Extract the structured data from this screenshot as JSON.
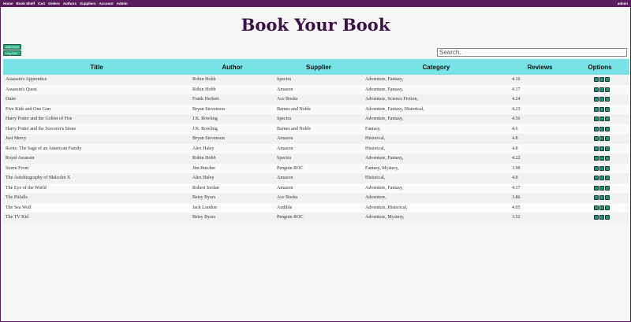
{
  "nav": {
    "links": [
      "Home",
      "Book Shelf",
      "Cart",
      "Orders",
      "Authors",
      "Suppliers",
      "Account",
      "Admin"
    ],
    "user": "admin"
  },
  "page_title": "Book Your Book",
  "buttons": {
    "add_book": "Add Book",
    "logout": "Log Out"
  },
  "search": {
    "placeholder": "Search.."
  },
  "table": {
    "headers": [
      "Title",
      "Author",
      "Supplier",
      "Category",
      "Reviews",
      "Options"
    ],
    "rows": [
      [
        "Assassin's Apprentice",
        "Robin Hobb",
        "Spectra",
        "Adventure, Fantasy,",
        "4.16"
      ],
      [
        "Assassin's Quest",
        "Robin Hobb",
        "Amazon",
        "Adventure, Fantasy,",
        "4.17"
      ],
      [
        "Dune",
        "Frank Herbert",
        "Ace Books",
        "Adventure, Science Fiction,",
        "4.24"
      ],
      [
        "Five Kids and One Gun",
        "Bryan Stevenson",
        "Barnes and Noble",
        "Adventure, Fantasy, Historical,",
        "4.23"
      ],
      [
        "Harry Potter and the Goblet of Fire",
        "J.K. Rowling",
        "Spectra",
        "Adventure, Fantasy,",
        "4.56"
      ],
      [
        "Harry Potter and the Sorcerer's Stone",
        "J.K. Rowling",
        "Barnes and Noble",
        "Fantasy,",
        "4.6"
      ],
      [
        "Just Mercy",
        "Bryan Stevenson",
        "Amazon",
        "Historical,",
        "4.8"
      ],
      [
        "Roots: The Saga of an American Family",
        "Alex Haley",
        "Amazon",
        "Historical,",
        "4.8"
      ],
      [
        "Royal Assassin",
        "Robin Hobb",
        "Spectra",
        "Adventure, Fantasy,",
        "4.22"
      ],
      [
        "Storm Front",
        "Jim Butcher",
        "Penguin ROC",
        "Fantasy, Mystery,",
        "3.98"
      ],
      [
        "The Autobiography of Malcolm X",
        "Alex Haley",
        "Amazon",
        "Historical,",
        "4.8"
      ],
      [
        "The Eye of the World",
        "Robert Jordan",
        "Amazon",
        "Adventure, Fantasy,",
        "4.17"
      ],
      [
        "The Pitfalls",
        "Betsy Byars",
        "Ace Books",
        "Adventure,",
        "3.86"
      ],
      [
        "The Sea Wolf",
        "Jack London",
        "Audible",
        "Adventure, Historical,",
        "4.05"
      ],
      [
        "The TV Kid",
        "Betsy Byars",
        "Penguin ROC",
        "Adventure, Mystery,",
        "3.52"
      ]
    ]
  }
}
